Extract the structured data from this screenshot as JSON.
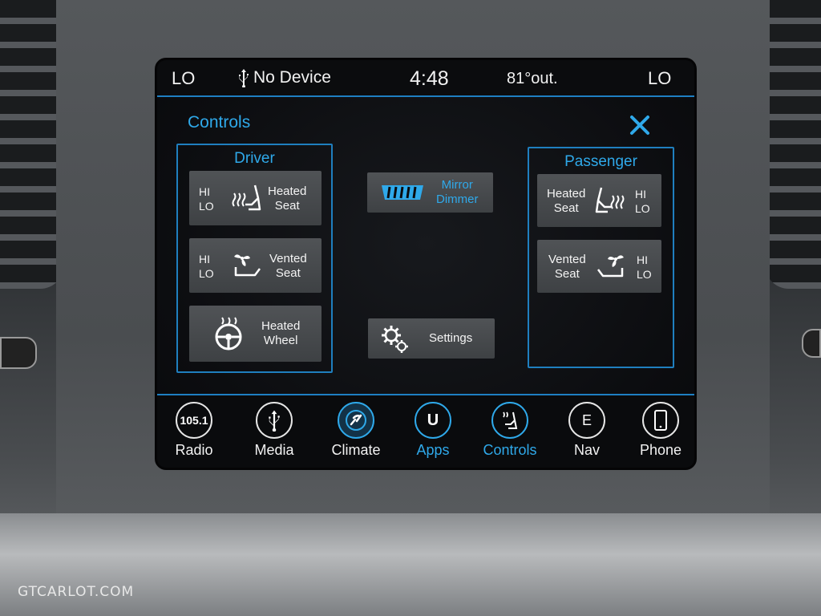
{
  "status": {
    "left_temp": "LO",
    "device": "No Device",
    "time": "4:48",
    "outside_temp": "81°out.",
    "right_temp": "LO"
  },
  "page_title": "Controls",
  "driver": {
    "title": "Driver",
    "heated_seat": {
      "hi": "HI",
      "lo": "LO",
      "label1": "Heated",
      "label2": "Seat"
    },
    "vented_seat": {
      "hi": "HI",
      "lo": "LO",
      "label1": "Vented",
      "label2": "Seat"
    },
    "heated_wheel": {
      "label1": "Heated",
      "label2": "Wheel"
    }
  },
  "center": {
    "mirror_dimmer": {
      "label1": "Mirror",
      "label2": "Dimmer"
    },
    "settings": {
      "label": "Settings"
    }
  },
  "passenger": {
    "title": "Passenger",
    "heated_seat": {
      "hi": "HI",
      "lo": "LO",
      "label1": "Heated",
      "label2": "Seat"
    },
    "vented_seat": {
      "hi": "HI",
      "lo": "LO",
      "label1": "Vented",
      "label2": "Seat"
    }
  },
  "nav": {
    "radio": {
      "icon_text": "105.1",
      "label": "Radio"
    },
    "media": {
      "label": "Media"
    },
    "climate": {
      "label": "Climate"
    },
    "apps": {
      "icon_text": "U",
      "label": "Apps"
    },
    "controls": {
      "label": "Controls"
    },
    "nav": {
      "icon_text": "E",
      "label": "Nav"
    },
    "phone": {
      "label": "Phone"
    }
  },
  "watermark": "GTCARLOT.COM",
  "colors": {
    "accent": "#2fa9ea",
    "divider": "#1e7fc2",
    "tile": "#46494c"
  }
}
